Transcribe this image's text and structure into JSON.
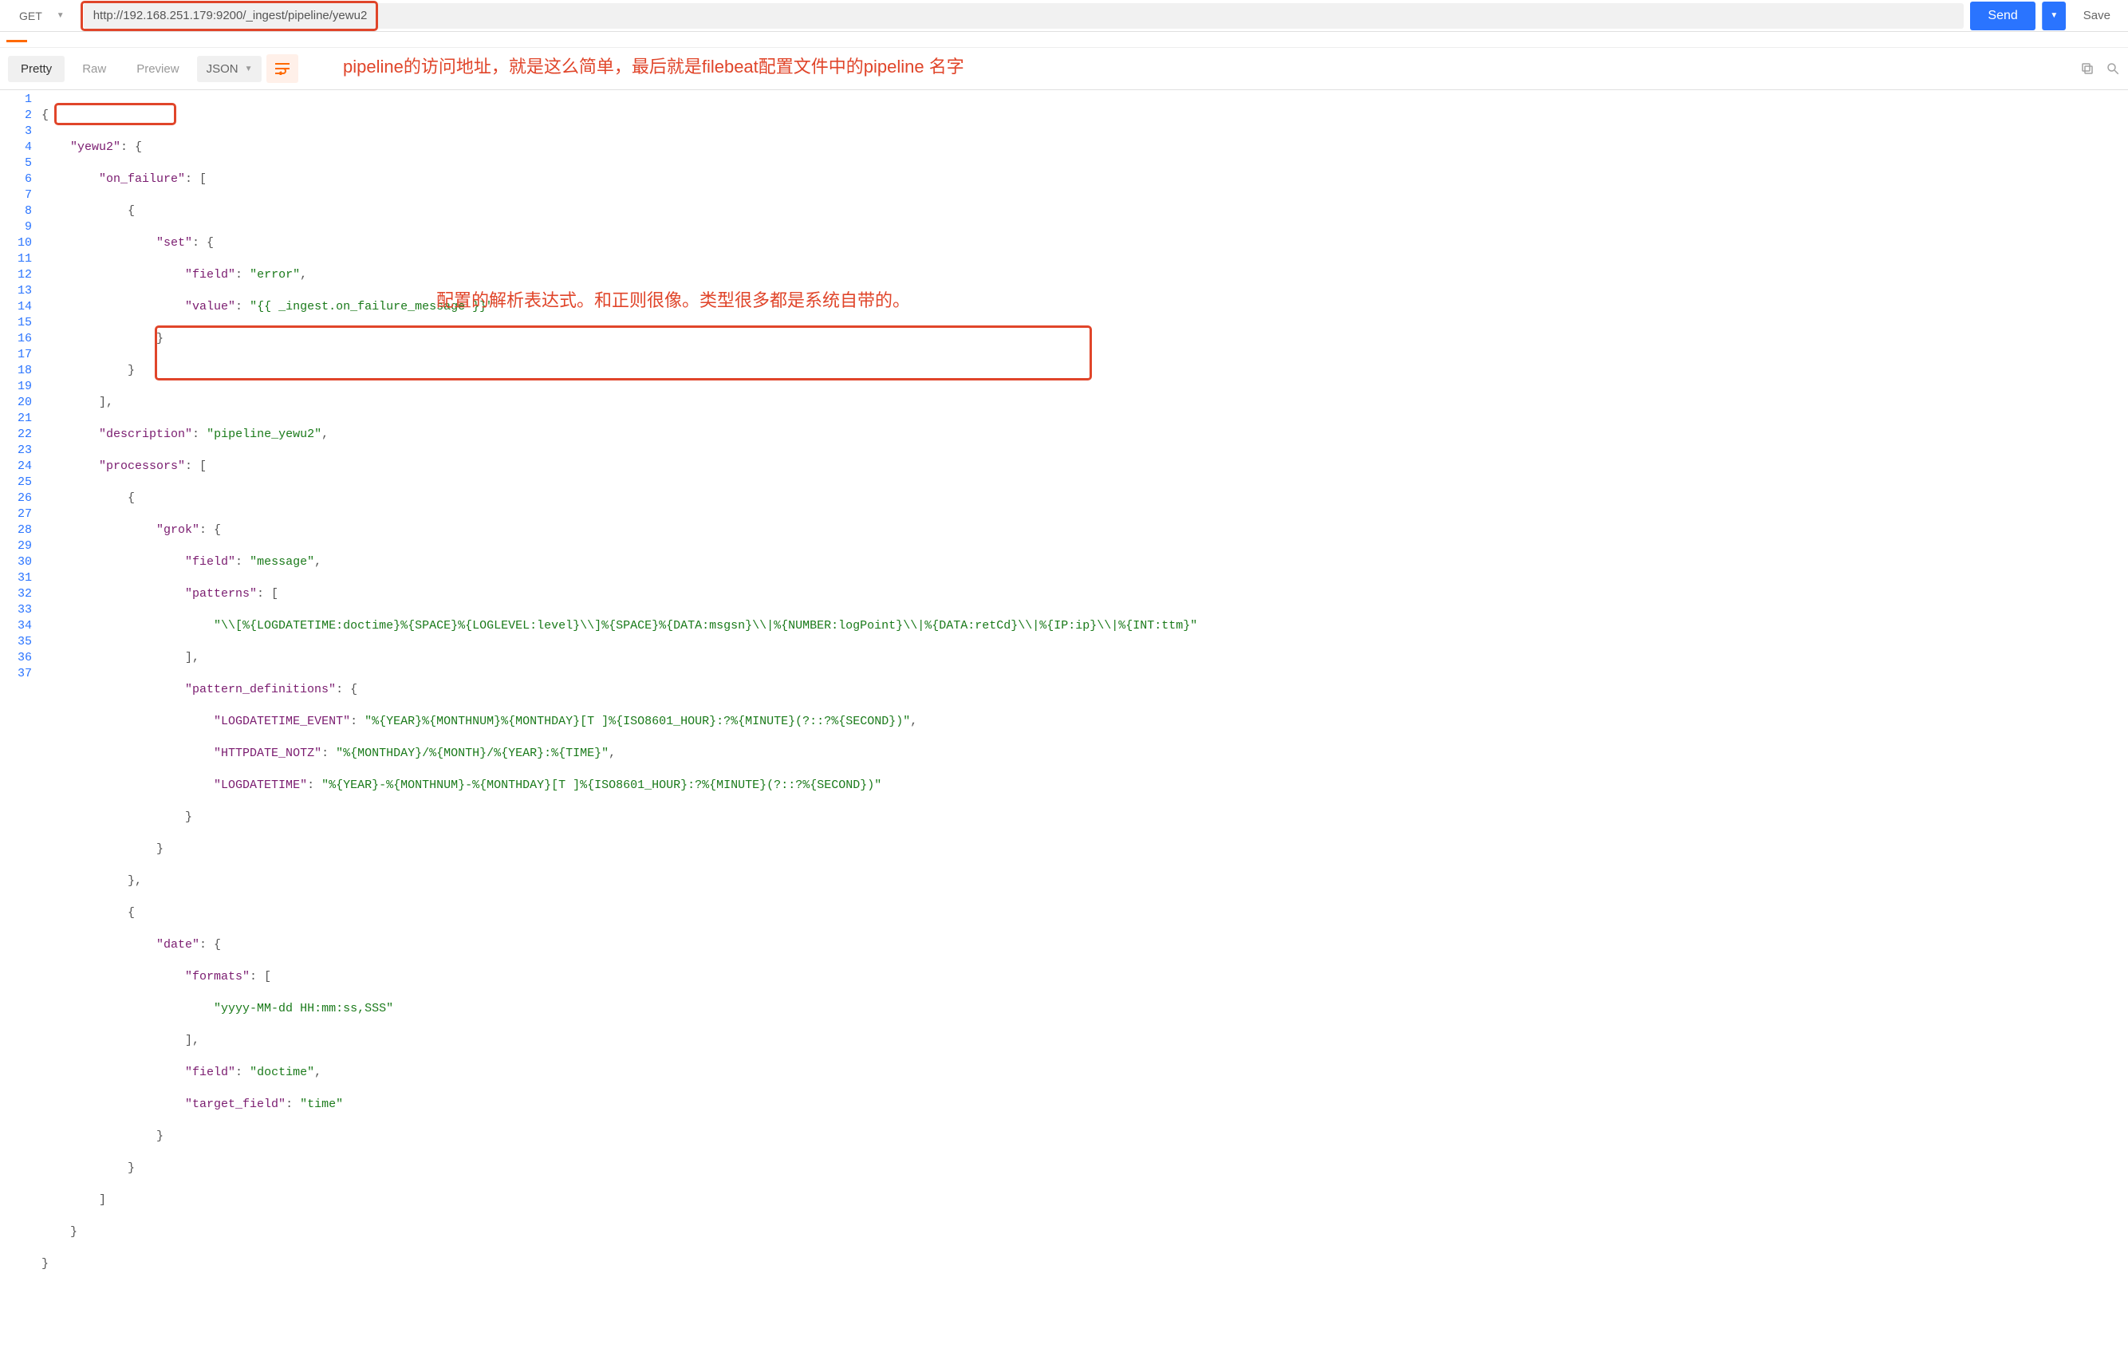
{
  "request": {
    "method": "GET",
    "url": "http://192.168.251.179:9200/_ingest/pipeline/yewu2",
    "send_label": "Send",
    "save_label": "Save"
  },
  "toolbar": {
    "pretty": "Pretty",
    "raw": "Raw",
    "preview": "Preview",
    "json": "JSON"
  },
  "annotations": {
    "top": "pipeline的访问地址，就是这么简单，最后就是filebeat配置文件中的pipeline 名字",
    "mid": "配置的解析表达式。和正则很像。类型很多都是系统自带的。"
  },
  "code": {
    "lines": 37,
    "l1": "{",
    "l2_k": "\"yewu2\"",
    "l2_rest": ": {",
    "l3_k": "\"on_failure\"",
    "l3_rest": ": [",
    "l4": "            {",
    "l5_k": "\"set\"",
    "l5_rest": ": {",
    "l6_k": "\"field\"",
    "l6_v": "\"error\"",
    "l6_c": ",",
    "l7_k": "\"value\"",
    "l7_v": "\"{{ _ingest.on_failure_message }}\"",
    "l8": "                }",
    "l9": "            }",
    "l10": "        ],",
    "l11_k": "\"description\"",
    "l11_v": "\"pipeline_yewu2\"",
    "l11_c": ",",
    "l12_k": "\"processors\"",
    "l12_rest": ": [",
    "l13": "            {",
    "l14_k": "\"grok\"",
    "l14_rest": ": {",
    "l15_k": "\"field\"",
    "l15_v": "\"message\"",
    "l15_c": ",",
    "l16_k": "\"patterns\"",
    "l16_rest": ": [",
    "l17_v": "\"\\\\[%{LOGDATETIME:doctime}%{SPACE}%{LOGLEVEL:level}\\\\]%{SPACE}%{DATA:msgsn}\\\\|%{NUMBER:logPoint}\\\\|%{DATA:retCd}\\\\|%{IP:ip}\\\\|%{INT:ttm}\"",
    "l18": "                    ],",
    "l19_k": "\"pattern_definitions\"",
    "l19_rest": ": {",
    "l20_k": "\"LOGDATETIME_EVENT\"",
    "l20_v": "\"%{YEAR}%{MONTHNUM}%{MONTHDAY}[T ]%{ISO8601_HOUR}:?%{MINUTE}(?::?%{SECOND})\"",
    "l20_c": ",",
    "l21_k": "\"HTTPDATE_NOTZ\"",
    "l21_v": "\"%{MONTHDAY}/%{MONTH}/%{YEAR}:%{TIME}\"",
    "l21_c": ",",
    "l22_k": "\"LOGDATETIME\"",
    "l22_v": "\"%{YEAR}-%{MONTHNUM}-%{MONTHDAY}[T ]%{ISO8601_HOUR}:?%{MINUTE}(?::?%{SECOND})\"",
    "l23": "                    }",
    "l24": "                }",
    "l25": "            },",
    "l26": "            {",
    "l27_k": "\"date\"",
    "l27_rest": ": {",
    "l28_k": "\"formats\"",
    "l28_rest": ": [",
    "l29_v": "\"yyyy-MM-dd HH:mm:ss,SSS\"",
    "l30": "                    ],",
    "l31_k": "\"field\"",
    "l31_v": "\"doctime\"",
    "l31_c": ",",
    "l32_k": "\"target_field\"",
    "l32_v": "\"time\"",
    "l33": "                }",
    "l34": "            }",
    "l35": "        ]",
    "l36": "    }",
    "l37": "}"
  }
}
